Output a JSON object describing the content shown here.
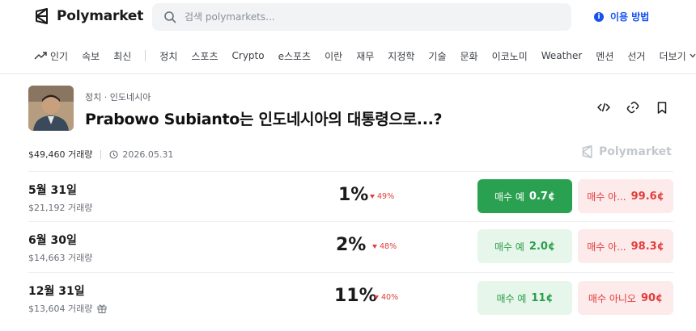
{
  "header": {
    "logo_text": "Polymarket",
    "search_placeholder": "검색 polymarkets...",
    "howto_label": "이용 방법"
  },
  "nav": {
    "items": [
      "인기",
      "속보",
      "최신",
      "정치",
      "스포츠",
      "Crypto",
      "e스포츠",
      "이란",
      "재무",
      "지정학",
      "기술",
      "문화",
      "이코노미",
      "Weather",
      "멘션",
      "선거",
      "더보기"
    ]
  },
  "market": {
    "breadcrumb": "정치 · 인도네시아",
    "title": "Prabowo Subianto는 인도네시아의 대통령으로...?",
    "volume": "$49,460 거래량",
    "end_date": "2026.05.31",
    "watermark": "Polymarket"
  },
  "outcomes": [
    {
      "date": "5월 31일",
      "volume": "$21,192 거래량",
      "pct": "1%",
      "change": "49%",
      "yes_label": "매수 예",
      "yes_price": "0.7¢",
      "no_label": "매수 아...",
      "no_price": "99.6¢"
    },
    {
      "date": "6월 30일",
      "volume": "$14,663 거래량",
      "pct": "2%",
      "change": "48%",
      "yes_label": "매수 예",
      "yes_price": "2.0¢",
      "no_label": "매수 아...",
      "no_price": "98.3¢"
    },
    {
      "date": "12월 31일",
      "volume": "$13,604 거래량",
      "pct": "11%",
      "change": "40%",
      "yes_label": "매수 예",
      "yes_price": "11¢",
      "no_label": "매수 아니오",
      "no_price": "90¢"
    }
  ],
  "colors": {
    "accent": "#1652f0",
    "yes": "#29a150",
    "no": "#e23c3c"
  }
}
